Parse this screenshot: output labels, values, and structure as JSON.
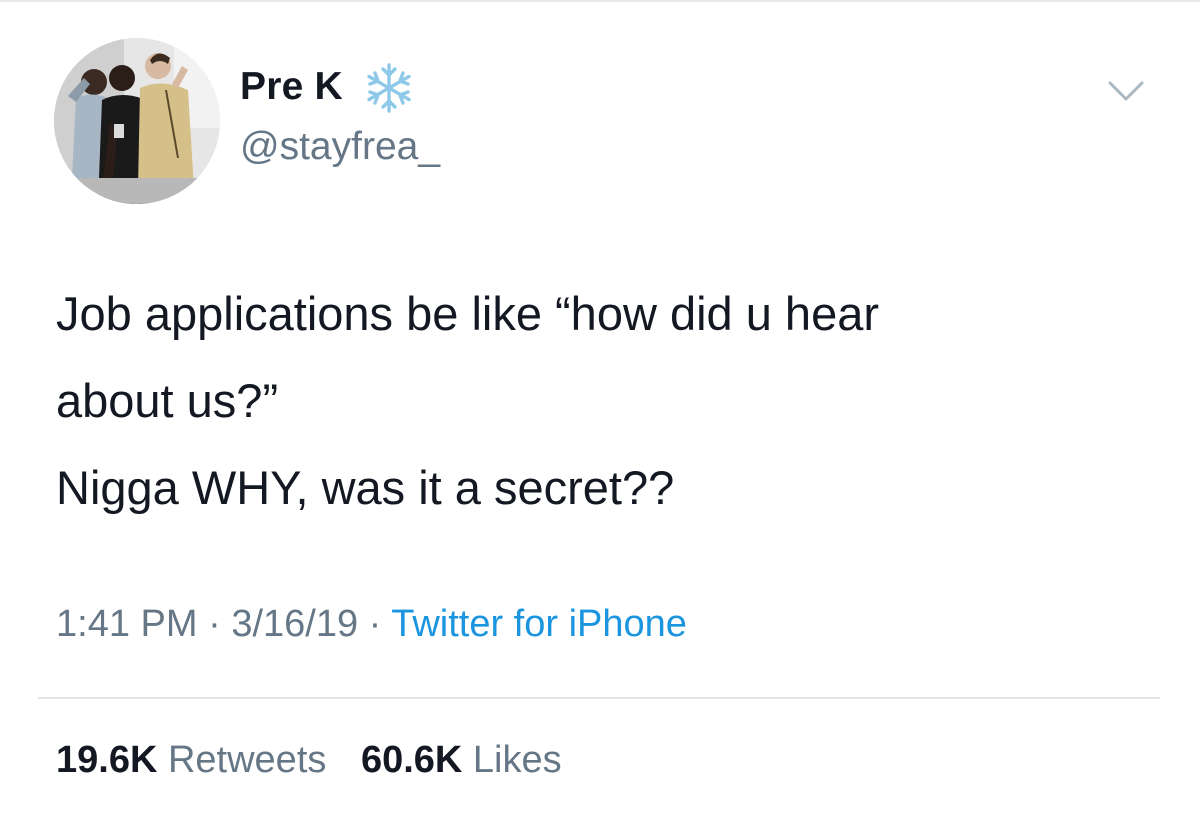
{
  "user": {
    "display_name": "Pre K",
    "handle": "@stayfrea_",
    "name_emoji": "snowflake-icon"
  },
  "tweet": {
    "lines": [
      "Job applications be like “how did u hear",
      "about us?”",
      "Nigga WHY, was it a secret??"
    ]
  },
  "meta": {
    "time": "1:41 PM",
    "separator": "·",
    "date": "3/16/19",
    "source": "Twitter for iPhone"
  },
  "stats": {
    "retweets_count": "19.6K",
    "retweets_label": "Retweets",
    "likes_count": "60.6K",
    "likes_label": "Likes"
  },
  "colors": {
    "text_primary": "#141823",
    "text_secondary": "#657786",
    "link": "#1b95e0",
    "divider": "#e3e6e8"
  }
}
